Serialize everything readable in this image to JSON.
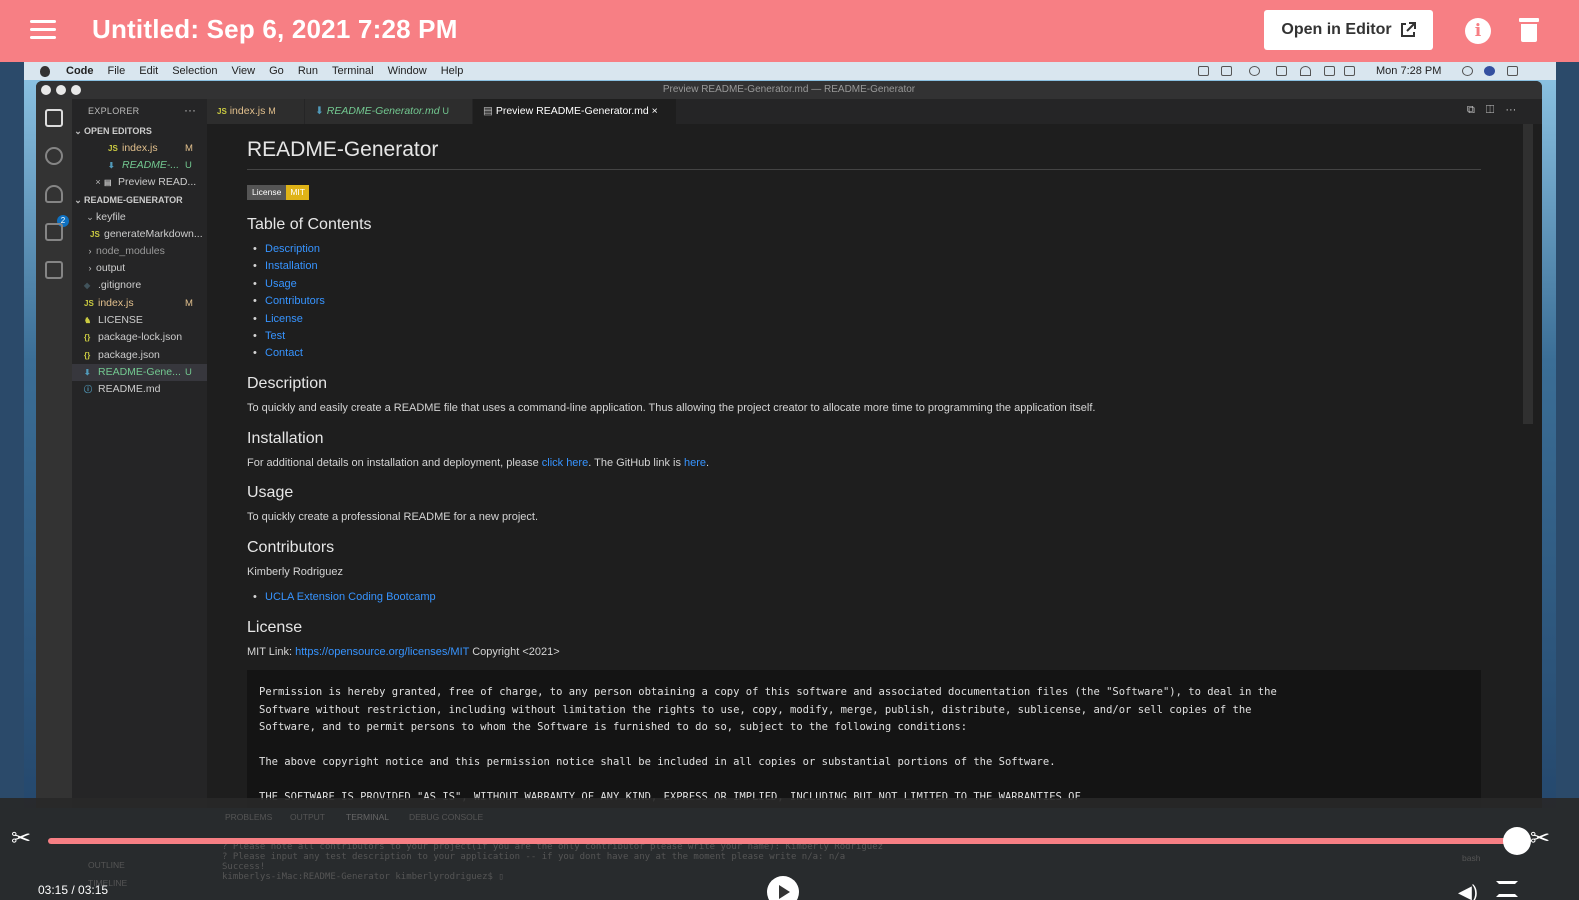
{
  "header": {
    "title": "Untitled: Sep 6, 2021 7:28 PM",
    "open_in_editor": "Open in Editor",
    "icons": [
      "menu-icon",
      "external-link-icon",
      "info-icon",
      "trash-icon"
    ]
  },
  "mac_menubar": {
    "items": [
      "Code",
      "File",
      "Edit",
      "Selection",
      "View",
      "Go",
      "Run",
      "Terminal",
      "Window",
      "Help"
    ],
    "clock": "Mon 7:28 PM"
  },
  "window": {
    "title": "Preview README-Generator.md — README-Generator"
  },
  "activity_badge": "2",
  "sidebar": {
    "header": "EXPLORER",
    "more": "···",
    "open_editors_label": "OPEN EDITORS",
    "open_editors": [
      {
        "icon": "JS",
        "name": "index.js",
        "badge": "M"
      },
      {
        "icon": "⬇",
        "name": "README-...",
        "badge": "U"
      },
      {
        "icon": "▤",
        "name": "Preview READ...",
        "badge": ""
      }
    ],
    "project_label": "README-GENERATOR",
    "tree": [
      {
        "name": "keyfile",
        "icon": "",
        "badge": ""
      },
      {
        "name": "generateMarkdown...",
        "icon": "JS",
        "badge": ""
      },
      {
        "name": "node_modules",
        "icon": "",
        "badge": ""
      },
      {
        "name": "output",
        "icon": "",
        "badge": ""
      },
      {
        "name": ".gitignore",
        "icon": "◆",
        "badge": ""
      },
      {
        "name": "index.js",
        "icon": "JS",
        "badge": "M"
      },
      {
        "name": "LICENSE",
        "icon": "♞",
        "badge": ""
      },
      {
        "name": "package-lock.json",
        "icon": "{}",
        "badge": ""
      },
      {
        "name": "package.json",
        "icon": "{}",
        "badge": ""
      },
      {
        "name": "README-Gene...",
        "icon": "⬇",
        "badge": "U"
      },
      {
        "name": "README.md",
        "icon": "ⓘ",
        "badge": ""
      }
    ]
  },
  "tabs": [
    {
      "icon": "JS",
      "label": "index.js",
      "badge": "M"
    },
    {
      "icon": "⬇",
      "label": "README-Generator.md",
      "badge": "U"
    },
    {
      "icon": "▤",
      "label": "Preview README-Generator.md",
      "badge": "×"
    }
  ],
  "preview": {
    "title": "README-Generator",
    "badge_left": "License",
    "badge_right": "MIT",
    "toc_heading": "Table of Contents",
    "toc": [
      "Description",
      "Installation",
      "Usage",
      "Contributors",
      "License",
      "Test",
      "Contact"
    ],
    "description_heading": "Description",
    "description_text": "To quickly and easily create a README file that uses a command-line application. Thus allowing the project creator to allocate more time to programming the application itself.",
    "installation_heading": "Installation",
    "installation_pre": "For additional details on installation and deployment, please ",
    "installation_link1": "click here",
    "installation_mid": ". The GitHub link is ",
    "installation_link2": "here",
    "installation_post": ".",
    "usage_heading": "Usage",
    "usage_text": "To quickly create a professional README for a new project.",
    "contributors_heading": "Contributors",
    "contributor_name": "Kimberly Rodriguez",
    "contributor_link": "UCLA Extension Coding Bootcamp",
    "license_heading": "License",
    "license_pre": "MIT Link: ",
    "license_link": "https://opensource.org/licenses/MIT",
    "license_post": " Copyright <2021>",
    "license_block": "Permission is hereby granted, free of charge, to any person obtaining a copy of this software and associated documentation files (the \"Software\"), to deal in the\nSoftware without restriction, including without limitation the rights to use, copy, modify, merge, publish, distribute, sublicense, and/or sell copies of the\nSoftware, and to permit persons to whom the Software is furnished to do so, subject to the following conditions:\n\nThe above copyright notice and this permission notice shall be included in all copies or substantial portions of the Software.\n\nTHE SOFTWARE IS PROVIDED \"AS IS\", WITHOUT WARRANTY OF ANY KIND, EXPRESS OR IMPLIED, INCLUDING BUT NOT LIMITED TO THE WARRANTIES OF"
  },
  "panel": {
    "tabs": [
      "PROBLEMS",
      "OUTPUT",
      "TERMINAL",
      "DEBUG CONSOLE"
    ],
    "outline": "OUTLINE",
    "timeline": "TIMELINE",
    "terminal_lines": "? Please note all contributors to your project(if you are the only contributor please write your name): Kimberly Rodriguez\n? Please input any test description to your application -- if you dont have any at the moment please write n/a: n/a\nSuccess!\nkimberlys-iMac:README-Generator kimberlyrodriguez$ ▯",
    "shell": "bash"
  },
  "player": {
    "time": "03:15 / 03:15",
    "progress": 1.0
  }
}
